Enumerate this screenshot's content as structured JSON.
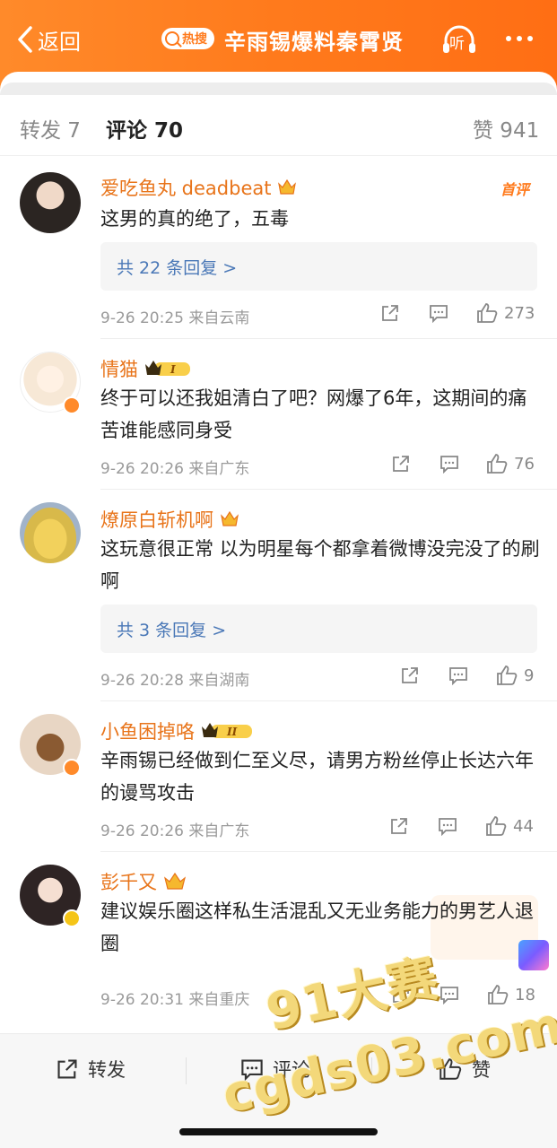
{
  "header": {
    "back_label": "返回",
    "hot_badge": "热搜",
    "title": "辛雨锡爆料秦霄贤",
    "listen_label": "听"
  },
  "tabs": {
    "repost": "转发 7",
    "comment": "评论 70",
    "like": "赞 941"
  },
  "comments": [
    {
      "username": "爱吃鱼丸 deadbeat",
      "tag": "首评",
      "text": "这男的真的绝了，五毒",
      "replies": "共 22 条回复 >",
      "meta": "9-26 20:25  来自云南",
      "likes": "273"
    },
    {
      "username": "情猫",
      "level": "I",
      "text": "终于可以还我姐清白了吧？网爆了6年，这期间的痛苦谁能感同身受",
      "meta": "9-26 20:26  来自广东",
      "likes": "76"
    },
    {
      "username": "燎原白斩机啊",
      "text": "这玩意很正常 以为明星每个都拿着微博没完没了的刷啊",
      "replies": "共 3 条回复 >",
      "meta": "9-26 20:28  来自湖南",
      "likes": "9"
    },
    {
      "username": "小鱼困掉咯",
      "level": "II",
      "text": "辛雨锡已经做到仁至义尽，请男方粉丝停止长达六年的谩骂攻击",
      "meta": "9-26 20:26  来自广东",
      "likes": "44"
    },
    {
      "username": "彭千又",
      "text": "建议娱乐圈这样私生活混乱又无业务能力的男艺人退圈",
      "meta": "9-26 20:31  来自重庆",
      "likes": "18"
    }
  ],
  "bottombar": {
    "repost": "转发",
    "comment": "评论",
    "like": "赞"
  },
  "watermark": {
    "line1": "91大赛",
    "line2": "cgds03.com"
  },
  "colors": {
    "brand_orange": "#ff7a1c",
    "username": "#e8741a",
    "reply_link": "#4a78b7"
  }
}
